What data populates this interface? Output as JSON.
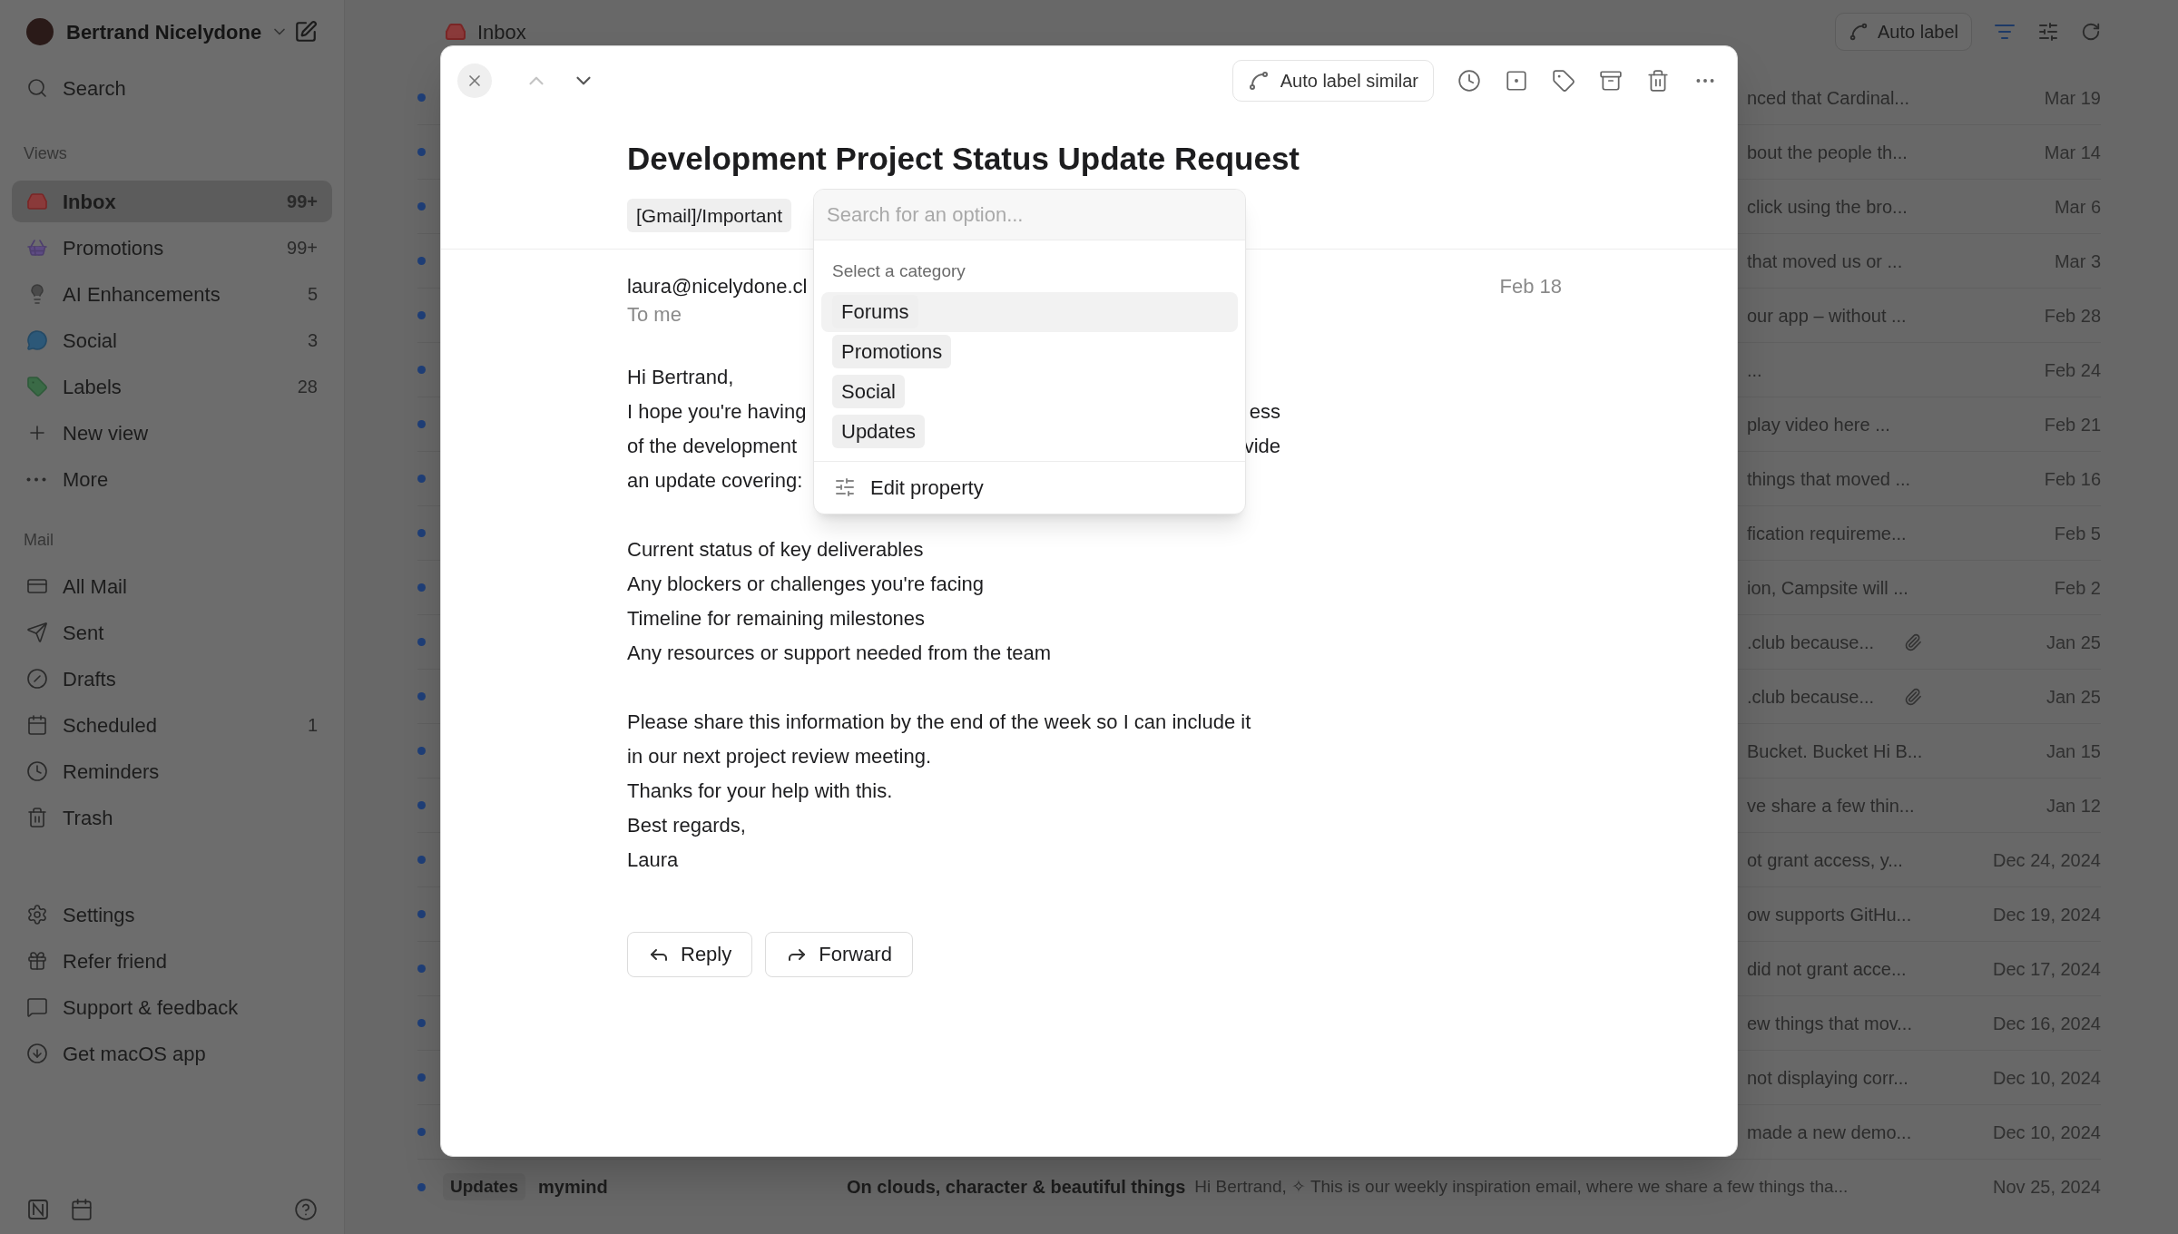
{
  "sidebar": {
    "account": "Bertrand Nicelydone",
    "search": "Search",
    "views_heading": "Views",
    "views": [
      {
        "label": "Inbox",
        "count": "99+",
        "selected": true
      },
      {
        "label": "Promotions",
        "count": "99+",
        "selected": false
      },
      {
        "label": "AI Enhancements",
        "count": "5",
        "selected": false
      },
      {
        "label": "Social",
        "count": "3",
        "selected": false
      },
      {
        "label": "Labels",
        "count": "28",
        "selected": false
      }
    ],
    "view_actions": [
      "New view",
      "More"
    ],
    "mail_heading": "Mail",
    "mail": [
      {
        "label": "All Mail"
      },
      {
        "label": "Sent"
      },
      {
        "label": "Drafts"
      },
      {
        "label": "Scheduled",
        "count": "1"
      },
      {
        "label": "Reminders"
      },
      {
        "label": "Trash"
      }
    ],
    "footer": [
      "Settings",
      "Refer friend",
      "Support & feedback",
      "Get macOS app"
    ]
  },
  "main": {
    "title": "Inbox",
    "auto_label": "Auto label",
    "rows": [
      {
        "snippet": "nced that Cardinal...",
        "date": "Mar 19",
        "unread": true,
        "attachment": false
      },
      {
        "snippet": "bout the people th...",
        "date": "Mar 14",
        "unread": true,
        "attachment": false
      },
      {
        "snippet": "click using the bro...",
        "date": "Mar 6",
        "unread": true,
        "attachment": false
      },
      {
        "snippet": "that moved us or ...",
        "date": "Mar 3",
        "unread": true,
        "attachment": false
      },
      {
        "snippet": "our app – without ...",
        "date": "Feb 28",
        "unread": true,
        "attachment": false
      },
      {
        "snippet": "...",
        "date": "Feb 24",
        "unread": true,
        "attachment": false
      },
      {
        "snippet": "play video here ...",
        "date": "Feb 21",
        "unread": true,
        "attachment": false
      },
      {
        "snippet": "things that moved ...",
        "date": "Feb 16",
        "unread": true,
        "attachment": false
      },
      {
        "snippet": "fication requireme...",
        "date": "Feb 5",
        "unread": true,
        "attachment": false
      },
      {
        "snippet": "ion, Campsite will ...",
        "date": "Feb 2",
        "unread": true,
        "attachment": false
      },
      {
        "snippet": ".club because...",
        "date": "Jan 25",
        "unread": true,
        "attachment": true
      },
      {
        "snippet": ".club because...",
        "date": "Jan 25",
        "unread": true,
        "attachment": true
      },
      {
        "snippet": "Bucket. Bucket Hi B...",
        "date": "Jan 15",
        "unread": true,
        "attachment": false
      },
      {
        "snippet": "ve share a few thin...",
        "date": "Jan 12",
        "unread": true,
        "attachment": false
      },
      {
        "snippet": "ot grant access, y...",
        "date": "Dec 24, 2024",
        "unread": true,
        "attachment": false
      },
      {
        "snippet": "ow supports GitHu...",
        "date": "Dec 19, 2024",
        "unread": true,
        "attachment": false
      },
      {
        "snippet": "did not grant acce...",
        "date": "Dec 17, 2024",
        "unread": true,
        "attachment": false
      },
      {
        "snippet": "ew things that mov...",
        "date": "Dec 16, 2024",
        "unread": true,
        "attachment": false
      },
      {
        "snippet": "not displaying corr...",
        "date": "Dec 10, 2024",
        "unread": true,
        "attachment": false
      },
      {
        "snippet": "made a new demo...",
        "date": "Dec 10, 2024",
        "unread": true,
        "attachment": false
      }
    ],
    "last_row": {
      "tag": "Updates",
      "sender": "mymind",
      "subject": "On clouds, character & beautiful things",
      "snippet": "Hi Bertrand, ✧ This is our weekly inspiration email, where we share a few things tha...",
      "date": "Nov 25, 2024",
      "unread": true
    }
  },
  "email": {
    "auto_label": "Auto label similar",
    "subject": "Development Project Status Update Request",
    "label": "[Gmail]/Important",
    "sender": "laura@nicelydone.cl",
    "recipient": "To me",
    "date": "Feb 18",
    "body": [
      [
        {
          "left": "Hi Bertrand,"
        },
        {
          "left": "I hope you're having",
          "right": "ess"
        },
        {
          "left": "of the development",
          "right": "vide"
        },
        {
          "left": "an update covering:"
        }
      ],
      [
        {
          "left": "Current status of key deliverables"
        },
        {
          "left": "Any blockers or challenges you're facing"
        },
        {
          "left": "Timeline for remaining milestones"
        },
        {
          "left": "Any resources or support needed from the team"
        }
      ],
      [
        {
          "left": "Please share this information by the end of the week so I can include it"
        },
        {
          "left": "in our next project review meeting."
        },
        {
          "left": "Thanks for your help with this."
        },
        {
          "left": "Best regards,"
        },
        {
          "left": "Laura"
        }
      ]
    ],
    "actions": [
      "Reply",
      "Forward"
    ]
  },
  "dropdown": {
    "placeholder": "Search for an option...",
    "heading": "Select a category",
    "options": [
      {
        "label": "Forums",
        "selected": true
      },
      {
        "label": "Promotions",
        "selected": false
      },
      {
        "label": "Social",
        "selected": false
      },
      {
        "label": "Updates",
        "selected": false
      }
    ],
    "footer": "Edit property"
  }
}
